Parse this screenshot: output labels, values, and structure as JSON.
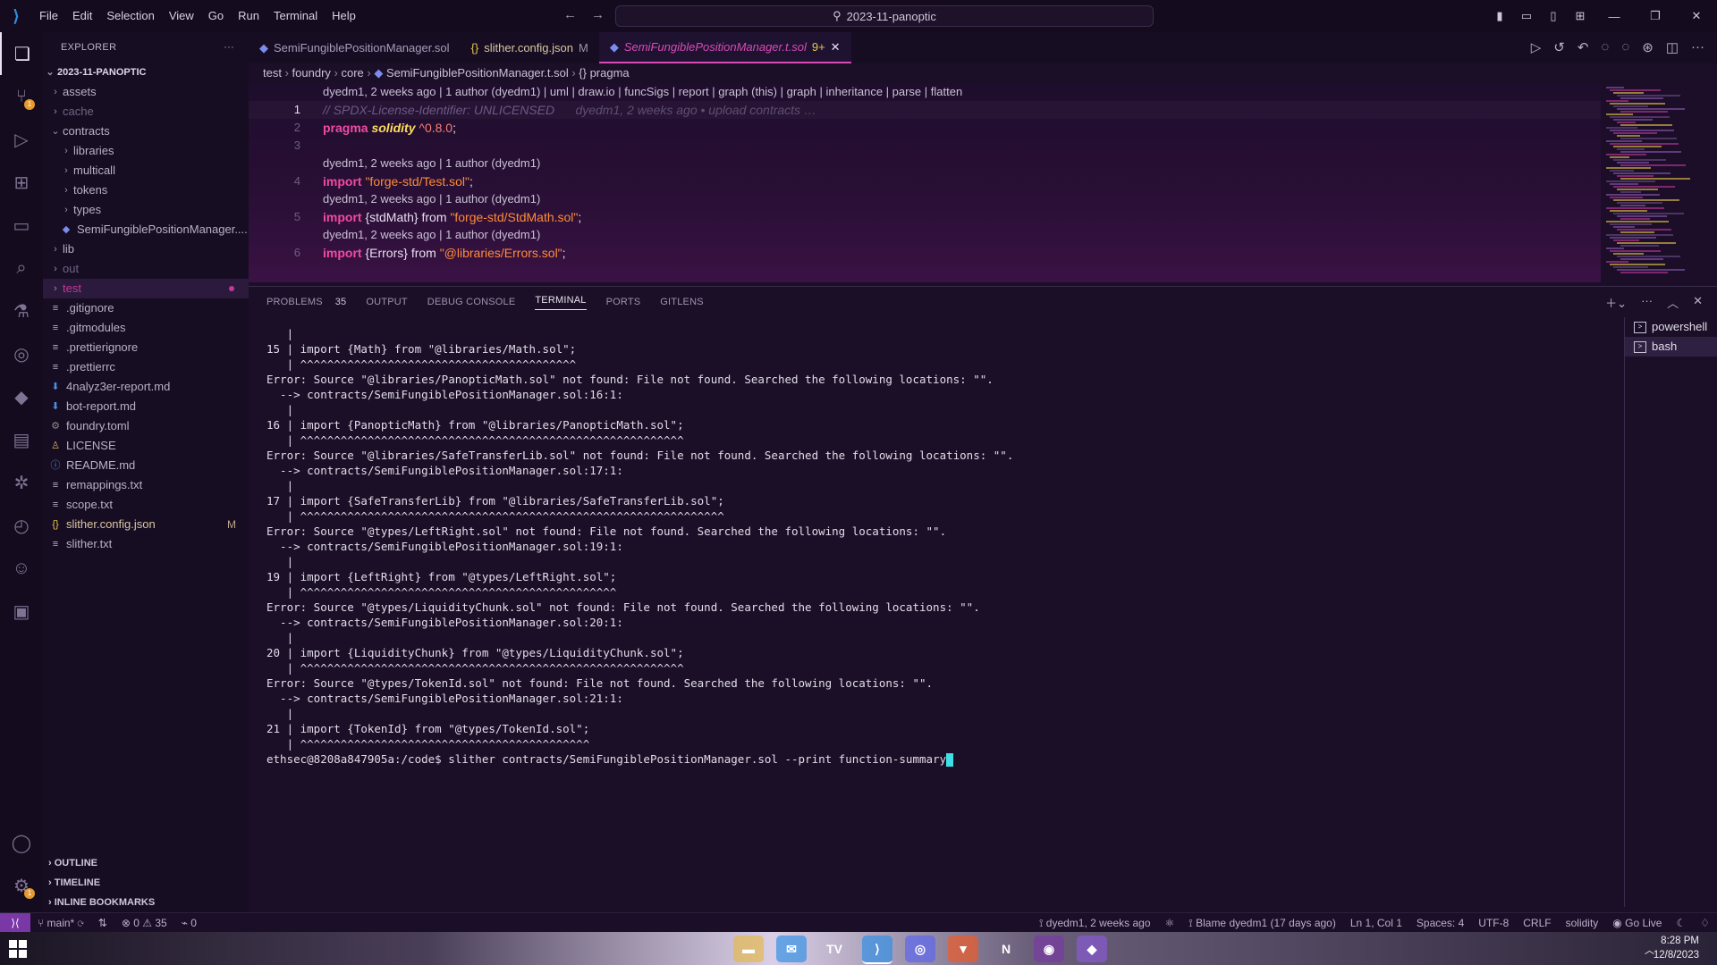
{
  "titlebar": {
    "menu": [
      "File",
      "Edit",
      "Selection",
      "View",
      "Go",
      "Run",
      "Terminal",
      "Help"
    ],
    "search": "2023-11-panoptic"
  },
  "activity": {
    "scm_badge": "1",
    "account_badge": "1"
  },
  "explorer": {
    "title": "EXPLORER",
    "root": "2023-11-PANOPTIC",
    "items": [
      {
        "label": "assets",
        "type": "folder",
        "depth": 1,
        "muted": false
      },
      {
        "label": "cache",
        "type": "folder",
        "depth": 1,
        "muted": true
      },
      {
        "label": "contracts",
        "type": "folder-open",
        "depth": 1,
        "muted": false
      },
      {
        "label": "libraries",
        "type": "folder",
        "depth": 2,
        "muted": false
      },
      {
        "label": "multicall",
        "type": "folder",
        "depth": 2,
        "muted": false
      },
      {
        "label": "tokens",
        "type": "folder",
        "depth": 2,
        "muted": false
      },
      {
        "label": "types",
        "type": "folder",
        "depth": 2,
        "muted": false
      },
      {
        "label": "SemiFungiblePositionManager....",
        "type": "sol",
        "depth": 2,
        "muted": false
      },
      {
        "label": "lib",
        "type": "folder",
        "depth": 1,
        "muted": false
      },
      {
        "label": "out",
        "type": "folder",
        "depth": 1,
        "muted": true
      },
      {
        "label": "test",
        "type": "folder",
        "depth": 1,
        "muted": false,
        "selected": true
      },
      {
        "label": ".gitignore",
        "type": "file",
        "depth": 1,
        "muted": false
      },
      {
        "label": ".gitmodules",
        "type": "file",
        "depth": 1,
        "muted": false
      },
      {
        "label": ".prettierignore",
        "type": "file",
        "depth": 1,
        "muted": false
      },
      {
        "label": ".prettierrc",
        "type": "file",
        "depth": 1,
        "muted": false
      },
      {
        "label": "4nalyz3er-report.md",
        "type": "md",
        "depth": 1,
        "muted": false
      },
      {
        "label": "bot-report.md",
        "type": "md",
        "depth": 1,
        "muted": false
      },
      {
        "label": "foundry.toml",
        "type": "gear",
        "depth": 1,
        "muted": false
      },
      {
        "label": "LICENSE",
        "type": "license",
        "depth": 1,
        "muted": false
      },
      {
        "label": "README.md",
        "type": "info",
        "depth": 1,
        "muted": false
      },
      {
        "label": "remappings.txt",
        "type": "file",
        "depth": 1,
        "muted": false
      },
      {
        "label": "scope.txt",
        "type": "file",
        "depth": 1,
        "muted": false
      },
      {
        "label": "slither.config.json",
        "type": "json",
        "depth": 1,
        "muted": false,
        "modified": "M"
      },
      {
        "label": "slither.txt",
        "type": "file",
        "depth": 1,
        "muted": false
      }
    ],
    "sections": [
      "OUTLINE",
      "TIMELINE",
      "INLINE BOOKMARKS"
    ]
  },
  "tabs": [
    {
      "label": "SemiFungiblePositionManager.sol",
      "icon": "sol",
      "mark": "",
      "active": false
    },
    {
      "label": "slither.config.json",
      "icon": "json",
      "mark": "M",
      "active": false
    },
    {
      "label": "SemiFungiblePositionManager.t.sol",
      "icon": "sol",
      "mark": "9+",
      "active": true
    }
  ],
  "breadcrumb": [
    "test",
    "foundry",
    "core",
    "SemiFungiblePositionManager.t.sol",
    "{} pragma"
  ],
  "editor": {
    "codelens_top": "dyedm1, 2 weeks ago | 1 author (dyedm1) | uml | draw.io | funcSigs | report | graph (this) | graph | inheritance | parse | flatten",
    "line1_comment": "// SPDX-License-Identifier: UNLICENSED",
    "line1_blame": "dyedm1, 2 weeks ago • upload contracts …",
    "line2": {
      "kw": "pragma",
      "ty": "solidity",
      "ver": "^0.8.0"
    },
    "codelens": "dyedm1, 2 weeks ago | 1 author (dyedm1)",
    "line4": {
      "kw": "import",
      "str": "\"forge-std/Test.sol\""
    },
    "line5": {
      "kw": "import",
      "name": "{stdMath}",
      "from": "from",
      "str": "\"forge-std/StdMath.sol\""
    },
    "line6": {
      "kw": "import",
      "name": "{Errors}",
      "from": "from",
      "str": "\"@libraries/Errors.sol\""
    }
  },
  "panel": {
    "tabs": [
      "PROBLEMS",
      "OUTPUT",
      "DEBUG CONSOLE",
      "TERMINAL",
      "PORTS",
      "GITLENS"
    ],
    "problems_count": "35",
    "active_tab": "TERMINAL",
    "terminals": [
      "powershell",
      "bash"
    ]
  },
  "terminal_lines": [
    "   |",
    "15 | import {Math} from \"@libraries/Math.sol\";",
    "   | ^^^^^^^^^^^^^^^^^^^^^^^^^^^^^^^^^^^^^^^^^",
    "",
    "Error: Source \"@libraries/PanopticMath.sol\" not found: File not found. Searched the following locations: \"\".",
    "  --> contracts/SemiFungiblePositionManager.sol:16:1:",
    "   |",
    "16 | import {PanopticMath} from \"@libraries/PanopticMath.sol\";",
    "   | ^^^^^^^^^^^^^^^^^^^^^^^^^^^^^^^^^^^^^^^^^^^^^^^^^^^^^^^^^",
    "",
    "Error: Source \"@libraries/SafeTransferLib.sol\" not found: File not found. Searched the following locations: \"\".",
    "  --> contracts/SemiFungiblePositionManager.sol:17:1:",
    "   |",
    "17 | import {SafeTransferLib} from \"@libraries/SafeTransferLib.sol\";",
    "   | ^^^^^^^^^^^^^^^^^^^^^^^^^^^^^^^^^^^^^^^^^^^^^^^^^^^^^^^^^^^^^^^",
    "",
    "Error: Source \"@types/LeftRight.sol\" not found: File not found. Searched the following locations: \"\".",
    "  --> contracts/SemiFungiblePositionManager.sol:19:1:",
    "   |",
    "19 | import {LeftRight} from \"@types/LeftRight.sol\";",
    "   | ^^^^^^^^^^^^^^^^^^^^^^^^^^^^^^^^^^^^^^^^^^^^^^^",
    "",
    "Error: Source \"@types/LiquidityChunk.sol\" not found: File not found. Searched the following locations: \"\".",
    "  --> contracts/SemiFungiblePositionManager.sol:20:1:",
    "   |",
    "20 | import {LiquidityChunk} from \"@types/LiquidityChunk.sol\";",
    "   | ^^^^^^^^^^^^^^^^^^^^^^^^^^^^^^^^^^^^^^^^^^^^^^^^^^^^^^^^^",
    "",
    "Error: Source \"@types/TokenId.sol\" not found: File not found. Searched the following locations: \"\".",
    "  --> contracts/SemiFungiblePositionManager.sol:21:1:",
    "   |",
    "21 | import {TokenId} from \"@types/TokenId.sol\";",
    "   | ^^^^^^^^^^^^^^^^^^^^^^^^^^^^^^^^^^^^^^^^^^^",
    "",
    "",
    "",
    "",
    ""
  ],
  "terminal_prompt": "ethsec@8208a847905a:/code$ slither contracts/SemiFungiblePositionManager.sol --print function-summary",
  "statusbar": {
    "branch": "main*",
    "errors": "0",
    "warnings": "35",
    "ports": "0",
    "blame_author": "dyedm1, 2 weeks ago",
    "blame": "Blame dyedm1 (17 days ago)",
    "position": "Ln 1, Col 1",
    "spaces": "Spaces: 4",
    "encoding": "UTF-8",
    "eol": "CRLF",
    "language": "solidity",
    "golive": "Go Live"
  },
  "taskbar": {
    "time": "8:28 PM",
    "date": "12/8/2023",
    "apps": [
      "file-explorer-icon",
      "mail-icon",
      "tradingview-icon",
      "vscode-icon",
      "discord-icon",
      "brave-icon",
      "notion-icon",
      "app-icon",
      "obsidian-icon"
    ]
  },
  "colors": {
    "accent": "#d84bb6",
    "keyword": "#f24aa2",
    "type": "#fede5d",
    "string": "#ff8b39",
    "cursor": "#3ee0e6"
  }
}
